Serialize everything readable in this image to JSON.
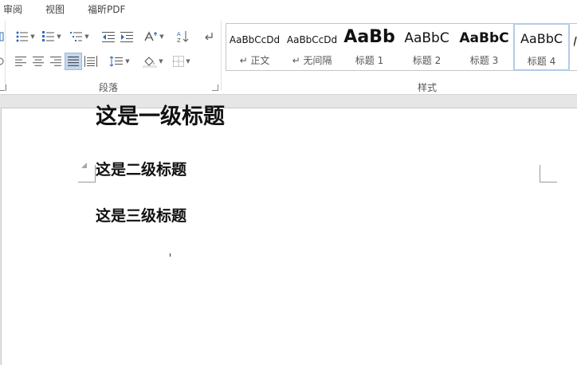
{
  "menu": {
    "tabs": [
      "审阅",
      "视图",
      "福昕PDF"
    ]
  },
  "ribbon": {
    "paragraph_group": {
      "label": "段落"
    },
    "styles_group": {
      "label": "样式",
      "items": [
        {
          "sample": "AaBbCcDd",
          "name": "↵ 正文"
        },
        {
          "sample": "AaBbCcDd",
          "name": "↵ 无间隔"
        },
        {
          "sample": "AaBb",
          "name": "标题 1"
        },
        {
          "sample": "AaBbC",
          "name": "标题 2"
        },
        {
          "sample": "AaBbC",
          "name": "标题 3"
        },
        {
          "sample": "AaBbC",
          "name": "标题 4"
        }
      ]
    }
  },
  "document": {
    "heading1": "这是一级标题",
    "heading2": "这是二级标题",
    "heading3": "这是三级标题"
  },
  "colors": {
    "active_button": "#c5d7ee",
    "selected_style_border": "#b3cbe8",
    "canvas_background": "#e6e6e6"
  }
}
